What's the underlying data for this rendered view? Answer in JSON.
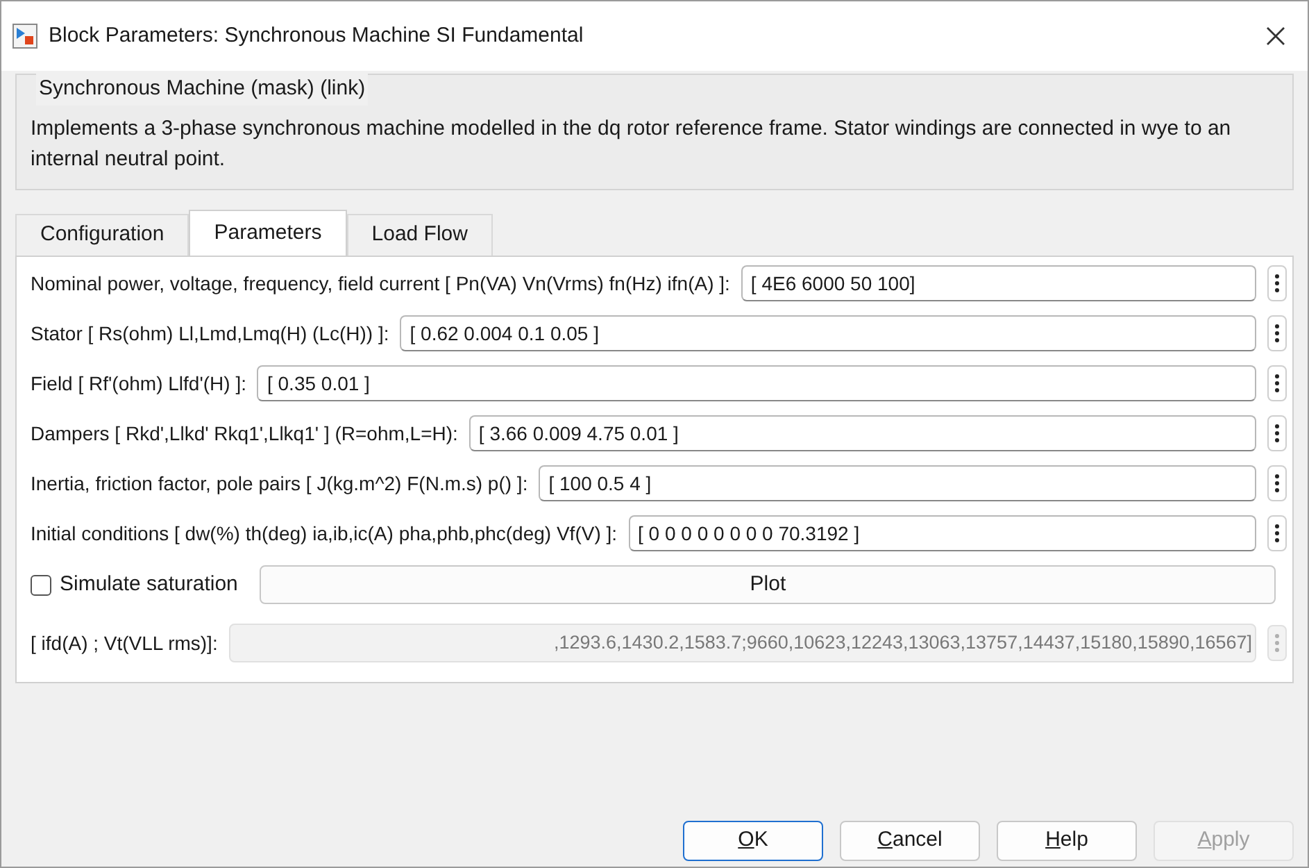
{
  "window": {
    "title": "Block Parameters: Synchronous Machine SI Fundamental"
  },
  "mask": {
    "title": "Synchronous Machine (mask) (link)",
    "description": "Implements a 3-phase synchronous machine modelled in the dq rotor reference frame. Stator windings are connected in wye to an internal neutral point."
  },
  "tabs": [
    {
      "label": "Configuration",
      "selected": false
    },
    {
      "label": "Parameters",
      "selected": true
    },
    {
      "label": "Load Flow",
      "selected": false
    }
  ],
  "parameters": [
    {
      "label": "Nominal power, voltage, frequency, field current  [ Pn(VA) Vn(Vrms) fn(Hz) ifn(A) ]:",
      "value": "[ 4E6  6000  50  100]"
    },
    {
      "label": "Stator  [ Rs(ohm)  Ll,Lmd,Lmq(H)  (Lc(H)) ]:",
      "value": "[ 0.62  0.004  0.1  0.05 ]"
    },
    {
      "label": "Field  [ Rf'(ohm)  Llfd'(H) ]:",
      "value": "[ 0.35  0.01 ]"
    },
    {
      "label": "Dampers   [ Rkd',Llkd'  Rkq1',Llkq1'  ] (R=ohm,L=H):",
      "value": "[ 3.66  0.009  4.75  0.01 ]"
    },
    {
      "label": "Inertia, friction factor, pole pairs [ J(kg.m^2)  F(N.m.s)  p() ]:",
      "value": "[ 100 0.5 4 ]"
    },
    {
      "label": "Initial conditions  [ dw(%)  th(deg)  ia,ib,ic(A)  pha,phb,phc(deg)  Vf(V) ]:",
      "value": "[ 0  0  0  0  0  0  0  0  70.3192 ]"
    }
  ],
  "saturation": {
    "label": "Simulate saturation",
    "checked": false,
    "plot_button": "Plot"
  },
  "saturation_parameters": {
    "label": "[ ifd(A) ; Vt(VLL rms)]:",
    "value": ",1293.6,1430.2,1583.7;9660,10623,12243,13063,13757,14437,15180,15890,16567]",
    "disabled": true
  },
  "buttons": [
    {
      "label": "OK",
      "disabled": false,
      "default": true
    },
    {
      "label": "Cancel",
      "disabled": false,
      "default": false
    },
    {
      "label": "Help",
      "disabled": false,
      "default": false
    },
    {
      "label": "Apply",
      "disabled": true,
      "default": false
    }
  ]
}
